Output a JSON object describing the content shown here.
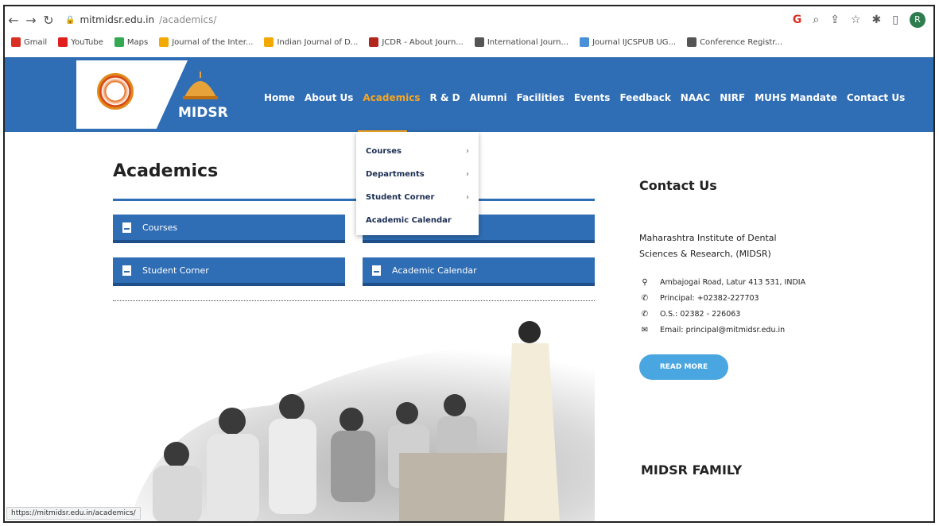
{
  "browser": {
    "url_host": "mitmidsr.edu.in",
    "url_path": "/academics/",
    "avatar": "R",
    "bookmarks": [
      {
        "label": "Gmail",
        "color": "#d93025"
      },
      {
        "label": "YouTube",
        "color": "#e02020"
      },
      {
        "label": "Maps",
        "color": "#34a853"
      },
      {
        "label": "Journal of the Inter...",
        "color": "#f2a900"
      },
      {
        "label": "Indian Journal of D...",
        "color": "#f2a900"
      },
      {
        "label": "JCDR - About Journ...",
        "color": "#b3261e"
      },
      {
        "label": "International Journ...",
        "color": "#555555"
      },
      {
        "label": "Journal IJCSPUB UG...",
        "color": "#4a90d9"
      },
      {
        "label": "Conference Registr...",
        "color": "#555555"
      }
    ],
    "status_url": "https://mitmidsr.edu.in/academics/"
  },
  "site": {
    "brand": "MIDSR",
    "nav": [
      "Home",
      "About Us",
      "Academics",
      "R & D",
      "Alumni",
      "Facilities",
      "Events",
      "Feedback",
      "NAAC",
      "NIRF",
      "MUHS Mandate",
      "Contact Us"
    ],
    "active_nav": "Academics",
    "dropdown": [
      "Courses",
      "Departments",
      "Student Corner",
      "Academic Calendar"
    ]
  },
  "main": {
    "title": "Academics",
    "tiles": [
      "Courses",
      "Student Corner",
      "Academic Calendar"
    ]
  },
  "contact": {
    "title": "Contact Us",
    "institute_line1": "Maharashtra Institute of Dental",
    "institute_line2": "Sciences & Research, (MIDSR)",
    "address": "Ambajogai Road, Latur 413 531, INDIA",
    "principal": "Principal: +02382-227703",
    "os": "O.S.: 02382 - 226063",
    "email": "Email: principal@mitmidsr.edu.in",
    "read_more": "READ MORE",
    "family_title": "MIDSR FAMILY"
  },
  "colors": {
    "header_blue": "#2f6db4",
    "accent_orange": "#f5a623",
    "button_blue": "#49a6e0"
  }
}
